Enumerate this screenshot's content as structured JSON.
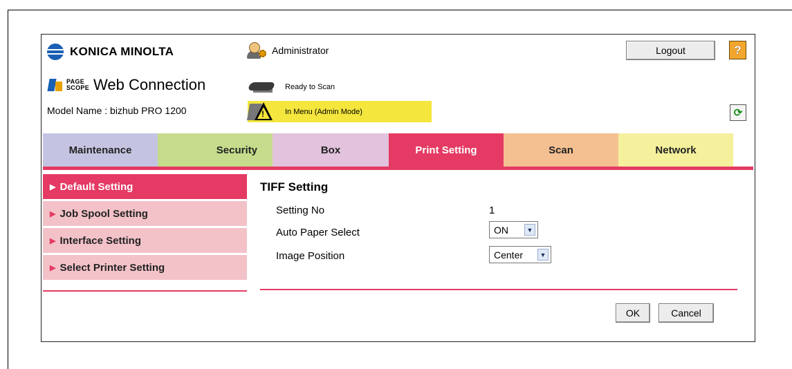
{
  "brand": {
    "name": "KONICA MINOLTA"
  },
  "app": {
    "page_scope_line1": "PAGE",
    "page_scope_line2": "SCOPE",
    "title": "Web Connection"
  },
  "model": {
    "label": "Model Name : bizhub PRO 1200"
  },
  "user": {
    "role": "Administrator"
  },
  "header_buttons": {
    "logout": "Logout",
    "help": "?",
    "refresh": "⟳"
  },
  "status": {
    "scanner": "Ready to Scan",
    "menu": "In Menu (Admin Mode)",
    "menu_bg": "#f4e63d"
  },
  "tabs": [
    {
      "label": "Maintenance"
    },
    {
      "label": "Security"
    },
    {
      "label": "Box"
    },
    {
      "label": "Print Setting",
      "active": true
    },
    {
      "label": "Scan"
    },
    {
      "label": "Network"
    }
  ],
  "sidebar": {
    "items": [
      {
        "label": "Default Setting",
        "active": true
      },
      {
        "label": "Job Spool Setting"
      },
      {
        "label": "Interface Setting"
      },
      {
        "label": "Select Printer Setting"
      }
    ],
    "arrow": "▶"
  },
  "main": {
    "title": "TIFF Setting",
    "fields": [
      {
        "label": "Setting No",
        "value": "1"
      },
      {
        "label": "Auto Paper Select",
        "value": "ON"
      },
      {
        "label": "Image Position",
        "value": "Center"
      }
    ],
    "ok": "OK",
    "cancel": "Cancel"
  },
  "colors": {
    "accent": "#e43a63",
    "sidebar_bg": "#f3c2c9"
  }
}
